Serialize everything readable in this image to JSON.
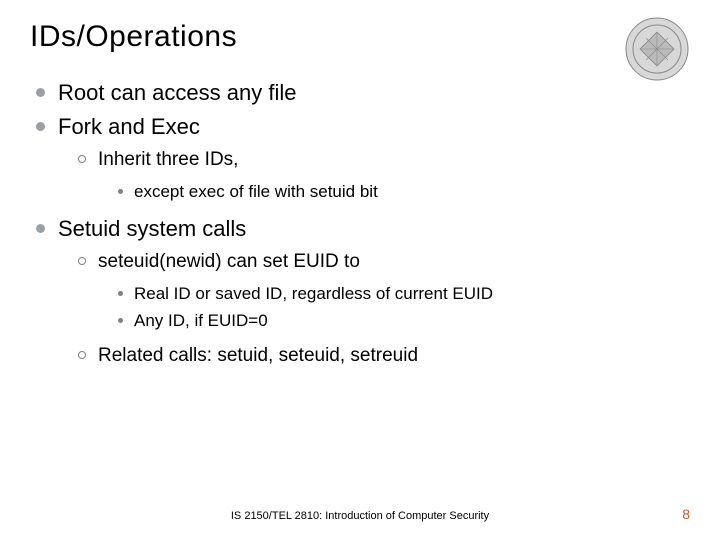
{
  "title": "IDs/Operations",
  "bullets": {
    "b1": "Root can access any file",
    "b2": "Fork and Exec",
    "b2_1": "Inherit three IDs,",
    "b2_1_1": "except exec of file with setuid bit",
    "b3": "Setuid system calls",
    "b3_1": "seteuid(newid) can set EUID to",
    "b3_1_1": "Real ID or saved ID, regardless of current EUID",
    "b3_1_2": "Any ID, if EUID=0",
    "b3_2": "Related calls: setuid, seteuid, setreuid"
  },
  "footer": {
    "course": "IS 2150/TEL 2810: Introduction of Computer Security",
    "page": "8"
  }
}
